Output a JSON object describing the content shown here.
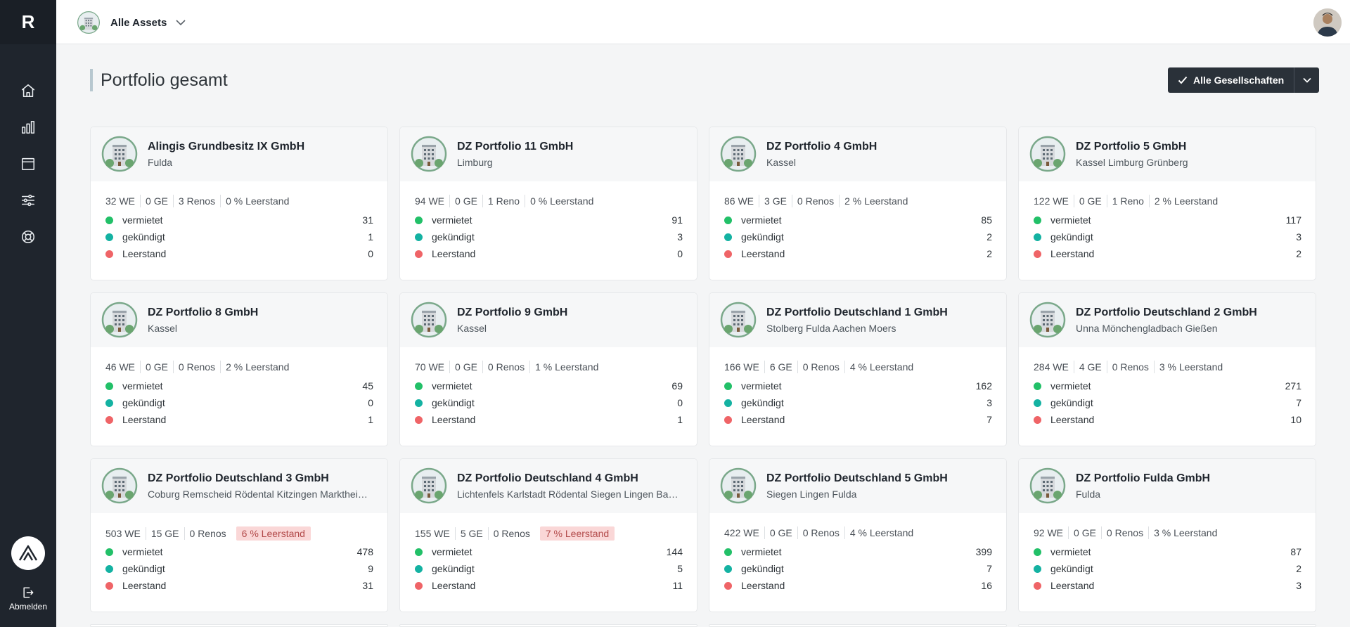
{
  "brand": {
    "logo_letter": "R"
  },
  "sidebar": {
    "items": [
      {
        "icon": "home-icon"
      },
      {
        "icon": "bar-chart-icon"
      },
      {
        "icon": "calendar-icon"
      },
      {
        "icon": "sliders-icon"
      },
      {
        "icon": "lifebuoy-icon"
      }
    ],
    "logout_label": "Abmelden"
  },
  "topbar": {
    "asset_label": "Alle Assets"
  },
  "page": {
    "title": "Portfolio gesamt",
    "filter_label": "Alle Gesellschaften"
  },
  "colors": {
    "vermietet": "#22c068",
    "gekuendigt": "#14b2a2",
    "leerstand": "#ef6467",
    "warning_bg": "#fad7d7"
  },
  "status_labels": {
    "vermietet": "vermietet",
    "gekuendigt": "gekündigt",
    "leerstand": "Leerstand"
  },
  "cards": [
    {
      "title": "Alingis Grundbesitz IX GmbH",
      "subtitle": "Fulda",
      "we": "32 WE",
      "ge": "0 GE",
      "renos": "3 Renos",
      "leerstand_pct": "0 % Leerstand",
      "warn": false,
      "vermietet": "31",
      "gekuendigt": "1",
      "leerstand": "0"
    },
    {
      "title": "DZ Portfolio 11 GmbH",
      "subtitle": "Limburg",
      "we": "94 WE",
      "ge": "0 GE",
      "renos": "1 Reno",
      "leerstand_pct": "0 % Leerstand",
      "warn": false,
      "vermietet": "91",
      "gekuendigt": "3",
      "leerstand": "0"
    },
    {
      "title": "DZ Portfolio 4 GmbH",
      "subtitle": "Kassel",
      "we": "86 WE",
      "ge": "3 GE",
      "renos": "0 Renos",
      "leerstand_pct": "2 % Leerstand",
      "warn": false,
      "vermietet": "85",
      "gekuendigt": "2",
      "leerstand": "2"
    },
    {
      "title": "DZ Portfolio 5 GmbH",
      "subtitle": "Kassel Limburg Grünberg",
      "we": "122 WE",
      "ge": "0 GE",
      "renos": "1 Reno",
      "leerstand_pct": "2 % Leerstand",
      "warn": false,
      "vermietet": "117",
      "gekuendigt": "3",
      "leerstand": "2"
    },
    {
      "title": "DZ Portfolio 8 GmbH",
      "subtitle": "Kassel",
      "we": "46 WE",
      "ge": "0 GE",
      "renos": "0 Renos",
      "leerstand_pct": "2 % Leerstand",
      "warn": false,
      "vermietet": "45",
      "gekuendigt": "0",
      "leerstand": "1"
    },
    {
      "title": "DZ Portfolio 9 GmbH",
      "subtitle": "Kassel",
      "we": "70 WE",
      "ge": "0 GE",
      "renos": "0 Renos",
      "leerstand_pct": "1 % Leerstand",
      "warn": false,
      "vermietet": "69",
      "gekuendigt": "0",
      "leerstand": "1"
    },
    {
      "title": "DZ Portfolio Deutschland 1 GmbH",
      "subtitle": "Stolberg Fulda Aachen Moers",
      "we": "166 WE",
      "ge": "6 GE",
      "renos": "0 Renos",
      "leerstand_pct": "4 % Leerstand",
      "warn": false,
      "vermietet": "162",
      "gekuendigt": "3",
      "leerstand": "7"
    },
    {
      "title": "DZ Portfolio Deutschland 2 GmbH",
      "subtitle": "Unna Mönchengladbach Gießen",
      "we": "284 WE",
      "ge": "4 GE",
      "renos": "0 Renos",
      "leerstand_pct": "3 % Leerstand",
      "warn": false,
      "vermietet": "271",
      "gekuendigt": "7",
      "leerstand": "10"
    },
    {
      "title": "DZ Portfolio Deutschland 3 GmbH",
      "subtitle": "Coburg Remscheid Rödental Kitzingen Marktheidenfeld",
      "we": "503 WE",
      "ge": "15 GE",
      "renos": "0 Renos",
      "leerstand_pct": "6 % Leerstand",
      "warn": true,
      "vermietet": "478",
      "gekuendigt": "9",
      "leerstand": "31"
    },
    {
      "title": "DZ Portfolio Deutschland 4 GmbH",
      "subtitle": "Lichtenfels Karlstadt Rödental Siegen Lingen Bad Kissingen",
      "we": "155 WE",
      "ge": "5 GE",
      "renos": "0 Renos",
      "leerstand_pct": "7 % Leerstand",
      "warn": true,
      "vermietet": "144",
      "gekuendigt": "5",
      "leerstand": "11"
    },
    {
      "title": "DZ Portfolio Deutschland 5 GmbH",
      "subtitle": "Siegen Lingen Fulda",
      "we": "422 WE",
      "ge": "0 GE",
      "renos": "0 Renos",
      "leerstand_pct": "4 % Leerstand",
      "warn": false,
      "vermietet": "399",
      "gekuendigt": "7",
      "leerstand": "16"
    },
    {
      "title": "DZ Portfolio Fulda GmbH",
      "subtitle": "Fulda",
      "we": "92 WE",
      "ge": "0 GE",
      "renos": "0 Renos",
      "leerstand_pct": "3 % Leerstand",
      "warn": false,
      "vermietet": "87",
      "gekuendigt": "2",
      "leerstand": "3"
    }
  ]
}
